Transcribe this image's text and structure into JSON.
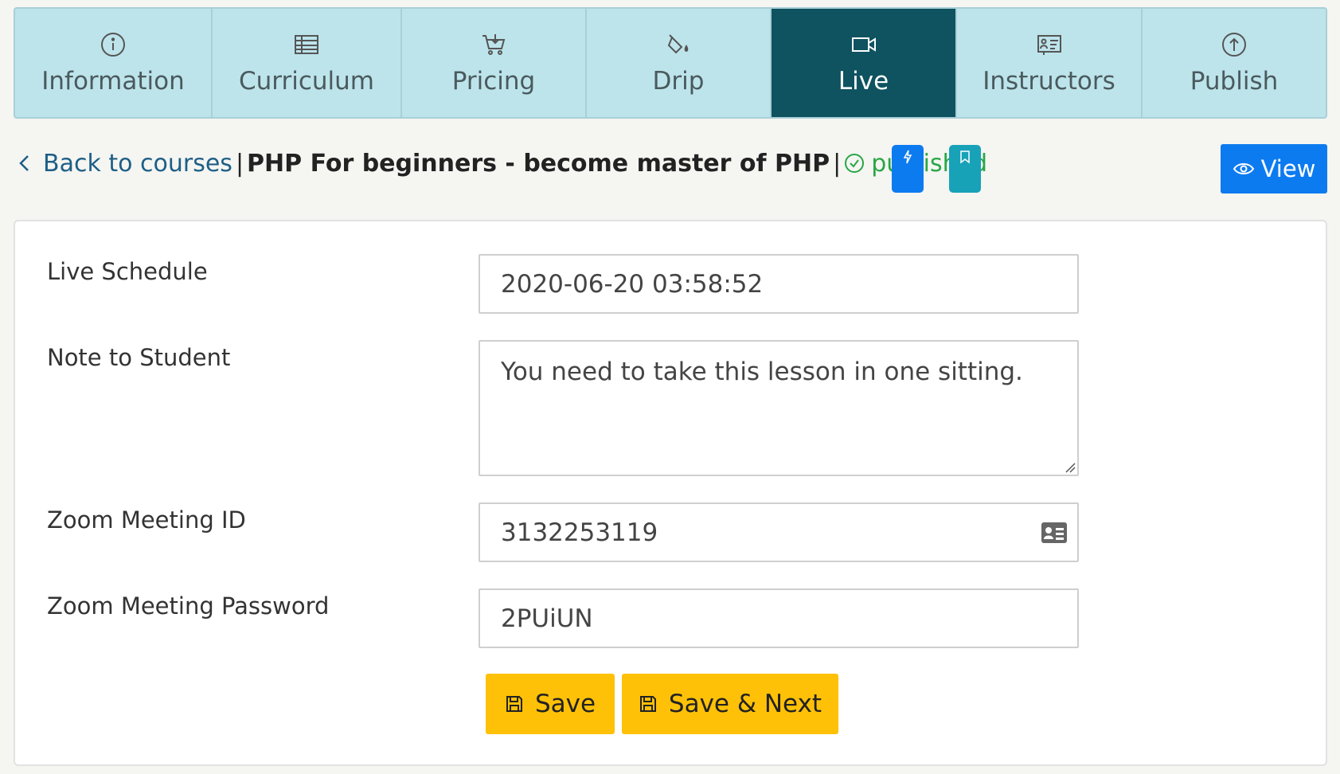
{
  "tabs": [
    {
      "label": "Information",
      "icon": "info-icon"
    },
    {
      "label": "Curriculum",
      "icon": "table-icon"
    },
    {
      "label": "Pricing",
      "icon": "cart-icon"
    },
    {
      "label": "Drip",
      "icon": "paint-bucket-icon"
    },
    {
      "label": "Live",
      "icon": "video-icon",
      "active": true
    },
    {
      "label": "Instructors",
      "icon": "instructors-icon"
    },
    {
      "label": "Publish",
      "icon": "upload-icon"
    }
  ],
  "breadcrumb": {
    "back_label": "Back to courses",
    "separator": "|",
    "course_title": "PHP For beginners - become master of PHP",
    "status": "published"
  },
  "actions": {
    "view_label": "View"
  },
  "form": {
    "live_schedule": {
      "label": "Live Schedule",
      "value": "2020-06-20 03:58:52"
    },
    "note": {
      "label": "Note to Student",
      "value": "You need to take this lesson in one sitting."
    },
    "zoom_id": {
      "label": "Zoom Meeting ID",
      "value": "3132253119"
    },
    "zoom_password": {
      "label": "Zoom Meeting Password",
      "value": "2PUiUN"
    },
    "save_label": "Save",
    "save_next_label": "Save & Next"
  },
  "colors": {
    "tab_bg": "#bde4eb",
    "tab_active": "#0e535f",
    "primary": "#0d7bf0",
    "teal": "#17a2b8",
    "success": "#27a745",
    "warning": "#ffc107"
  }
}
